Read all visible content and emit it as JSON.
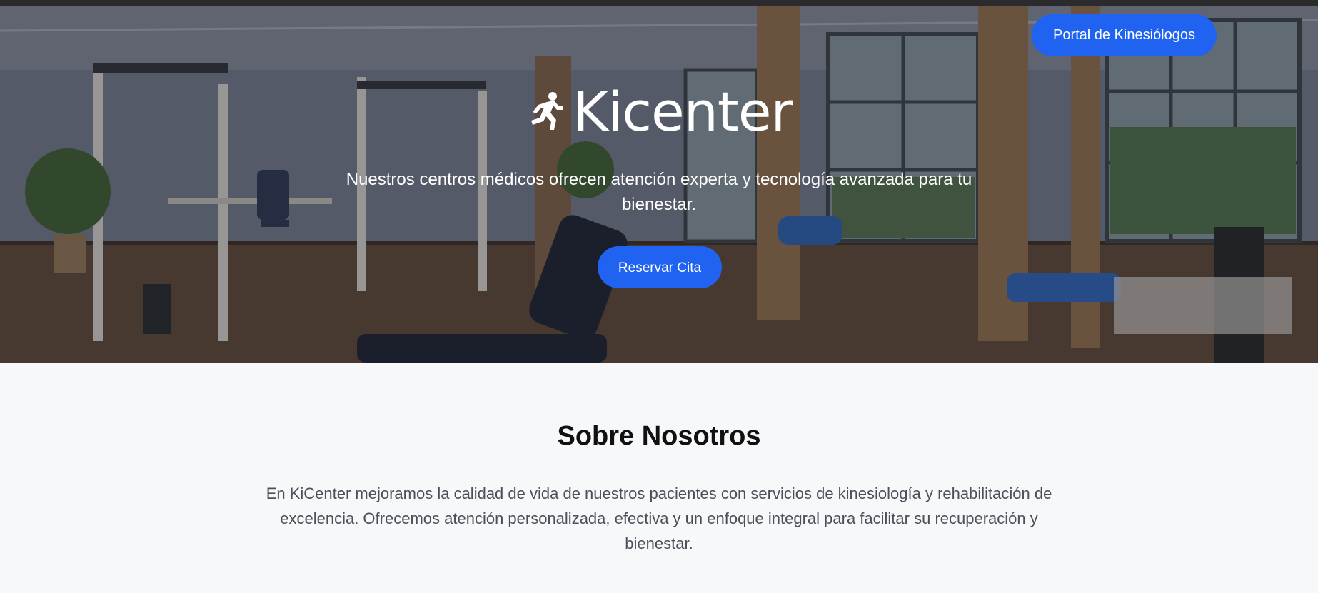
{
  "header": {
    "portal_button": "Portal de Kinesiólogos"
  },
  "hero": {
    "brand_icon": "runner-icon",
    "brand_name": "Kicenter",
    "tagline": "Nuestros centros médicos ofrecen atención experta y tecnología avanzada para tu bienestar.",
    "cta_button": "Reservar Cita",
    "background": "physiotherapy-gym-photo"
  },
  "about": {
    "title": "Sobre Nosotros",
    "text": "En KiCenter mejoramos la calidad de vida de nuestros pacientes con servicios de kinesiología y rehabilitación de excelencia. Ofrecemos atención personalizada, efectiva y un enfoque integral para facilitar su recuperación y bienestar."
  },
  "colors": {
    "accent": "#1f63f0",
    "section_bg": "#f7f8fa",
    "heading": "#111111",
    "body_text": "#4a4f59"
  }
}
